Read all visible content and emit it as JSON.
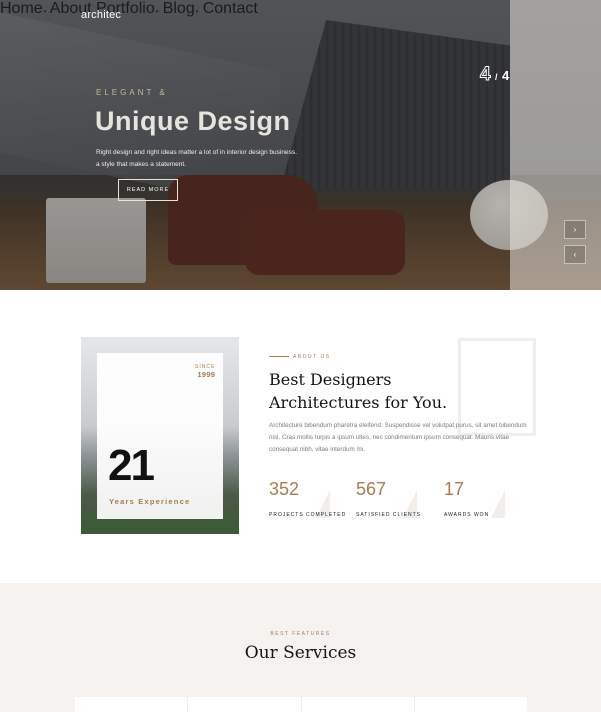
{
  "nav": {
    "logo": "architec",
    "items": [
      {
        "label": "Home",
        "has_dropdown": true
      },
      {
        "label": "About",
        "has_dropdown": false
      },
      {
        "label": "Portfolio",
        "has_dropdown": true
      },
      {
        "label": "Blog",
        "has_dropdown": true
      },
      {
        "label": "Contact",
        "has_dropdown": false
      }
    ],
    "caret": "▾"
  },
  "hero": {
    "eyebrow": "ELEGANT &",
    "title": "Unique Design",
    "text_line1": "Right design and right ideas matter a lot of in interior design business.",
    "text_line2": "a style that makes a statement.",
    "button": "READ MORE",
    "slide_current": "4",
    "slide_separator": "/",
    "slide_total": "4",
    "next_arrow": "›",
    "prev_arrow": "‹"
  },
  "about": {
    "since_label": "SINCE",
    "since_year": "1999",
    "big_number": "21",
    "years_label": "Years Experience",
    "eyebrow": "ABOUT US",
    "title_line1": "Best Designers",
    "title_line2": "Architectures for You.",
    "text": "Architecture bibendum pharetra eleifend. Suspendisse vel volutpat purus, sit amet bibendum nisl. Cras mollis turpis a ipsum ultes, nec condimentum ipsum consequat. Mauris vitae consequat nibh, vitae interdum mi.",
    "stats": [
      {
        "value": "352",
        "label": "PROJECTS COMPLETED"
      },
      {
        "value": "567",
        "label": "SATISFIED CLIENTS"
      },
      {
        "value": "17",
        "label": "AWARDS WON"
      }
    ]
  },
  "services": {
    "eyebrow": "BEST FEATURES",
    "title": "Our Services"
  },
  "colors": {
    "accent": "#a67c52",
    "services_bg": "#f5f2ef"
  }
}
